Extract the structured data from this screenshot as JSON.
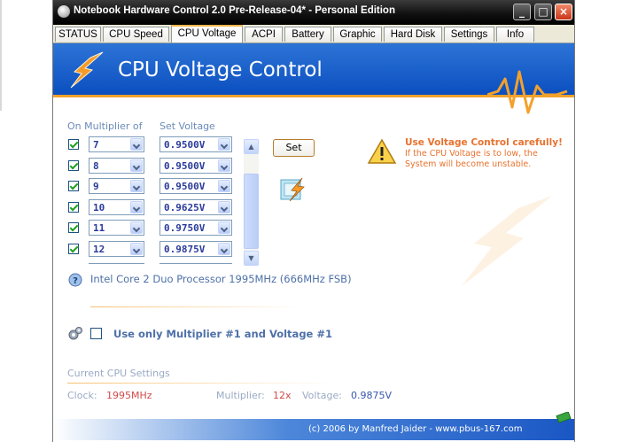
{
  "window": {
    "title": "Notebook Hardware Control 2.0 Pre-Release-04*  -  Personal Edition",
    "minimize_label": "_",
    "maximize_label": "□",
    "close_label": "×"
  },
  "tabs": [
    {
      "label": "STATUS"
    },
    {
      "label": "CPU Speed"
    },
    {
      "label": "CPU Voltage",
      "active": true
    },
    {
      "label": "ACPI"
    },
    {
      "label": "Battery"
    },
    {
      "label": "Graphic"
    },
    {
      "label": "Hard Disk"
    },
    {
      "label": "Settings"
    },
    {
      "label": "Info"
    }
  ],
  "banner": {
    "title": "CPU Voltage Control"
  },
  "table": {
    "col_multiplier": "On Multiplier of",
    "col_voltage": "Set Voltage",
    "rows": [
      {
        "checked": true,
        "multiplier": "7",
        "voltage": "0.9500V"
      },
      {
        "checked": true,
        "multiplier": "8",
        "voltage": "0.9500V"
      },
      {
        "checked": true,
        "multiplier": "9",
        "voltage": "0.9500V"
      },
      {
        "checked": true,
        "multiplier": "10",
        "voltage": "0.9625V"
      },
      {
        "checked": true,
        "multiplier": "11",
        "voltage": "0.9750V"
      },
      {
        "checked": true,
        "multiplier": "12",
        "voltage": "0.9875V"
      }
    ]
  },
  "set_button": "Set",
  "warning": {
    "title": "Use Voltage Control carefully!",
    "text": "If the CPU Voltage is to low, the System will become unstable."
  },
  "cpu_info": "Intel Core 2 Duo Processor 1995MHz (666MHz FSB)",
  "use_only": {
    "checked": false,
    "label": "Use only Multiplier #1 and Voltage #1"
  },
  "current": {
    "title": "Current CPU Settings",
    "clock_label": "Clock:",
    "clock_value": "1995MHz",
    "multiplier_label": "Multiplier:",
    "multiplier_value": "12x",
    "voltage_label": "Voltage:",
    "voltage_value": "0.9875V"
  },
  "footer": "(c) 2006 by Manfred Jaider  -  www.pbus-167.com",
  "colors": {
    "banner_blue": "#0b4fc0",
    "accent_orange": "#f3a12c",
    "warning_orange": "#e8722f",
    "label_blue": "#4e70a8",
    "value_red": "#d24a4a"
  }
}
